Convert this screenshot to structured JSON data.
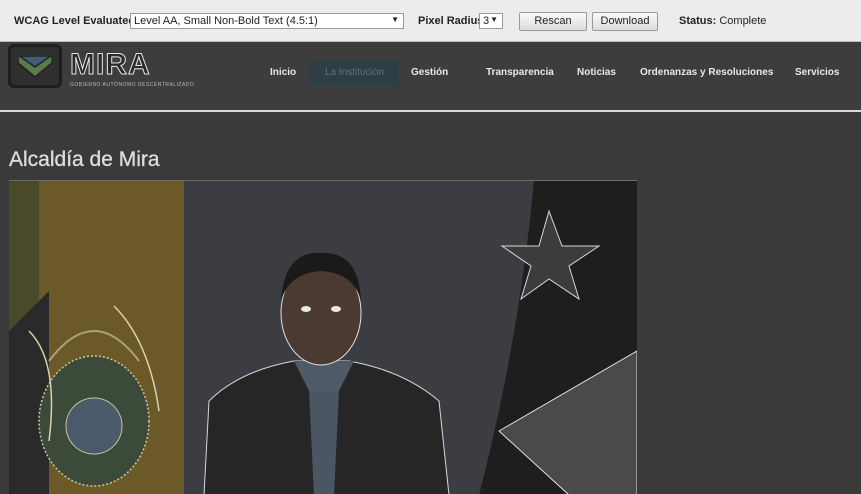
{
  "toolbar": {
    "wcag_label": "WCAG Level Evaluated:",
    "wcag_value": "Level AA, Small Non-Bold Text (4.5:1)",
    "radius_label": "Pixel Radius:",
    "radius_value": "3",
    "rescan_label": "Rescan",
    "download_label": "Download",
    "status_label": "Status:",
    "status_value": "Complete"
  },
  "site": {
    "brand": "MIRA",
    "brand_sub": "GOBIERNO AUTÓNOMO DESCENTRALIZADO"
  },
  "nav": {
    "items": [
      {
        "label": "Inicio"
      },
      {
        "label": "La Institución"
      },
      {
        "label": "Gestión"
      },
      {
        "label": "Transparencia"
      },
      {
        "label": "Noticias"
      },
      {
        "label": "Ordenanzas y Resoluciones"
      },
      {
        "label": "Servicios"
      }
    ]
  },
  "main": {
    "title": "Alcaldía de Mira"
  },
  "colors": {
    "toolbar_bg": "#ececec",
    "header_bg": "#3d3d3d",
    "nav_active_bg": "#2f3d45",
    "page_bg": "#3a3a3a"
  }
}
